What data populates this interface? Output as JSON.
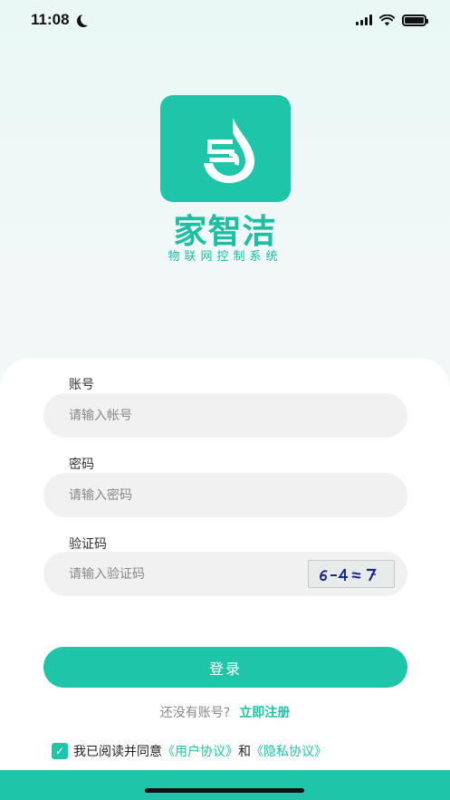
{
  "status_bar": {
    "time": "11:08"
  },
  "brand": {
    "name": "家智洁",
    "subtitle": "物联网控制系统"
  },
  "form": {
    "account": {
      "label": "账号",
      "placeholder": "请输入帐号"
    },
    "password": {
      "label": "密码",
      "placeholder": "请输入密码"
    },
    "captcha": {
      "label": "验证码",
      "placeholder": "请输入验证码",
      "image_text": "6-4≈7"
    }
  },
  "login_button": "登录",
  "register": {
    "question": "还没有账号?",
    "link": "立即注册"
  },
  "agreement": {
    "prefix": "我已阅读并同意",
    "user_agreement": "《用户协议》",
    "and": "和",
    "privacy_agreement": "《隐私协议》"
  },
  "colors": {
    "accent": "#1ec5a9",
    "field_bg": "#f1f1f1"
  }
}
